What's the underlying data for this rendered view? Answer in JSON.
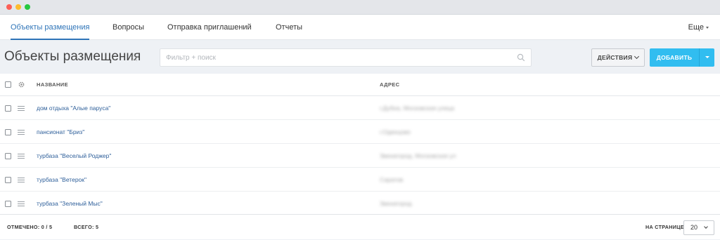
{
  "nav": {
    "tabs": [
      {
        "label": "Объекты размещения",
        "active": true
      },
      {
        "label": "Вопросы",
        "active": false
      },
      {
        "label": "Отправка приглашений",
        "active": false
      },
      {
        "label": "Отчеты",
        "active": false
      }
    ],
    "more_label": "Еще"
  },
  "header": {
    "title": "Объекты размещения",
    "search_placeholder": "Фильтр + поиск",
    "actions_label": "ДЕЙСТВИЯ",
    "add_label": "ДОБАВИТЬ"
  },
  "table": {
    "columns": {
      "name": "НАЗВАНИЕ",
      "address": "АДРЕС"
    },
    "rows": [
      {
        "name": "дом отдыха \"Алые паруса\"",
        "address": "г.Дубна, Московская улица"
      },
      {
        "name": "пансионат \"Бриз\"",
        "address": "г.Одинцово"
      },
      {
        "name": "турбаза \"Веселый Роджер\"",
        "address": "Звенигород, Московская ул"
      },
      {
        "name": "турбаза \"Ветерок\"",
        "address": "Саратов"
      },
      {
        "name": "турбаза \"Зеленый Мыс\"",
        "address": "Звенигород"
      }
    ]
  },
  "footer": {
    "selected": "ОТМЕЧЕНО: 0 / 5",
    "total": "ВСЕГО: 5",
    "per_page_label": "НА СТРАНИЦЕ:",
    "per_page_value": "20"
  },
  "colors": {
    "accent": "#2e74b8",
    "add_button": "#31bdf0",
    "link": "#2e5f9a"
  }
}
